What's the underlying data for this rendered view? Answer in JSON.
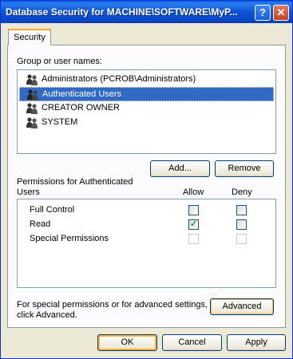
{
  "window": {
    "title": "Database Security for MACHINE\\SOFTWARE\\MyP...",
    "help_glyph": "?",
    "close_glyph": "✕"
  },
  "tabs": [
    {
      "label": "Security",
      "active": true
    }
  ],
  "group_label": "Group or user names:",
  "users": [
    {
      "label": "Administrators (PCROB\\Administrators)",
      "selected": false,
      "icon": "user-group-icon"
    },
    {
      "label": "Authenticated Users",
      "selected": true,
      "icon": "user-group-icon"
    },
    {
      "label": "CREATOR OWNER",
      "selected": false,
      "icon": "user-group-icon"
    },
    {
      "label": "SYSTEM",
      "selected": false,
      "icon": "user-group-icon"
    }
  ],
  "buttons": {
    "add": "Add...",
    "remove": "Remove",
    "advanced": "Advanced",
    "ok": "OK",
    "cancel": "Cancel",
    "apply": "Apply"
  },
  "permissions": {
    "label_line1": "Permissions for Authenticated",
    "label_line2": "Users",
    "allow_header": "Allow",
    "deny_header": "Deny",
    "rows": [
      {
        "name": "Full Control",
        "allow": false,
        "deny": false,
        "disabled": false
      },
      {
        "name": "Read",
        "allow": true,
        "deny": false,
        "disabled": false
      },
      {
        "name": "Special Permissions",
        "allow": false,
        "deny": false,
        "disabled": true
      }
    ]
  },
  "advanced_hint": {
    "line1": "For special permissions or for advanced settings,",
    "line2": "click Advanced."
  },
  "colors": {
    "title_bar": "#0a5fd8",
    "selection": "#316ac5",
    "check": "#21a121"
  }
}
